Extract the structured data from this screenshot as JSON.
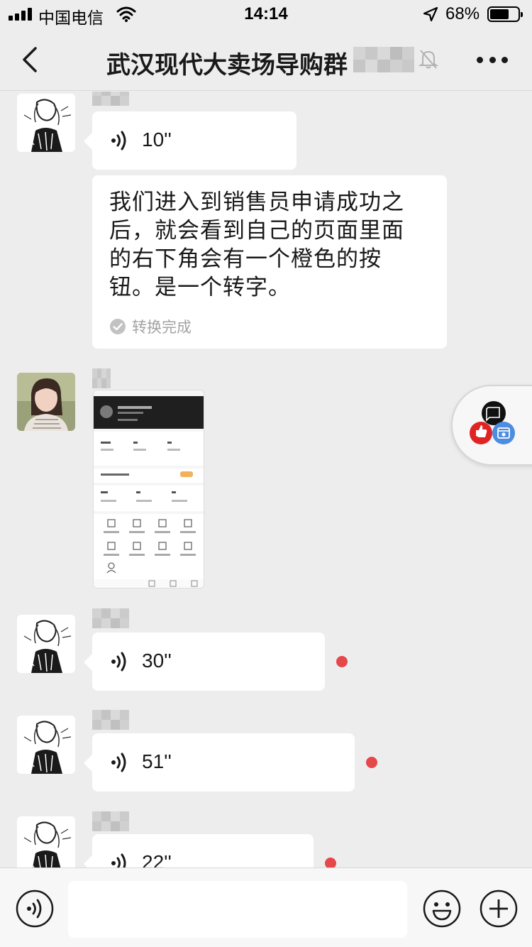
{
  "status_bar": {
    "carrier": "中国电信",
    "time": "14:14",
    "battery_percent": "68%",
    "battery_level": 0.68
  },
  "nav": {
    "title": "武汉现代大卖场导购群",
    "back_icon": "chevron-left-icon",
    "mute_icon": "bell-slash-icon",
    "more_icon": "more-dots-icon"
  },
  "messages": [
    {
      "type": "voice",
      "duration": "10''",
      "unread": false
    },
    {
      "type": "text",
      "lines": [
        "我们进入到销售员申请成功之",
        "后，就会看到自己的页面里面",
        "的右下角会有一个橙色的按",
        "钮。是一个转字。"
      ],
      "status": "转换完成"
    },
    {
      "type": "image"
    },
    {
      "type": "voice",
      "duration": "30''",
      "unread": true
    },
    {
      "type": "voice",
      "duration": "51''",
      "unread": true
    },
    {
      "type": "voice",
      "duration": "22''",
      "unread": true
    }
  ],
  "input_bar": {
    "voice_icon": "voice-toggle-icon",
    "emoji_icon": "emoji-icon",
    "plus_icon": "plus-icon",
    "value": ""
  },
  "colors": {
    "background": "#ededed",
    "bubble": "#ffffff",
    "unread": "#e5474b"
  }
}
